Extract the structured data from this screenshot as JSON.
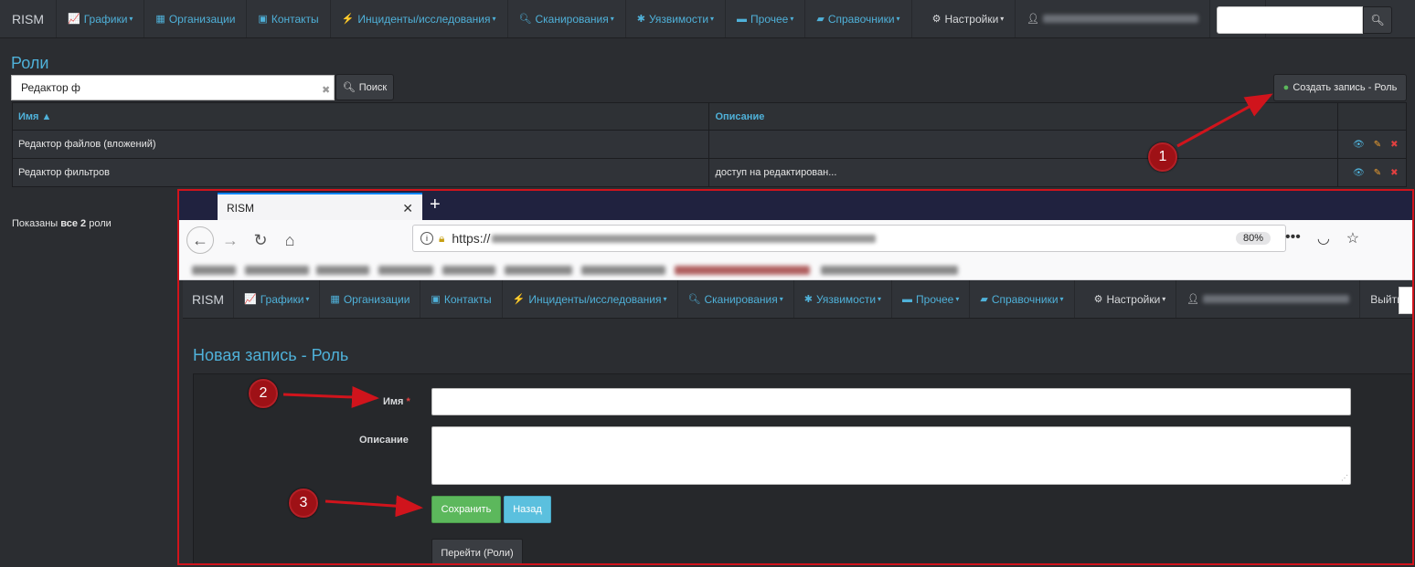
{
  "app": {
    "brand": "RISM"
  },
  "nav": {
    "items": [
      "Графики",
      "Организации",
      "Контакты",
      "Инциденты/исследования",
      "Сканирования",
      "Уязвимости",
      "Прочее",
      "Справочники"
    ],
    "settings": "Настройки",
    "logout": "Выйти"
  },
  "roles_page": {
    "title": "Роли",
    "filter_value": "Редактор ф",
    "search_button": "Поиск",
    "create_button": "Создать запись - Роль",
    "columns": [
      "Имя ▲",
      "Описание"
    ],
    "rows": [
      {
        "name": "Редактор файлов (вложений)",
        "description": ""
      },
      {
        "name": "Редактор фильтров",
        "description": "доступ на редактирован..."
      }
    ],
    "count_prefix": "Показаны",
    "count_bold": "все 2",
    "count_suffix": "роли"
  },
  "browser": {
    "tab_title": "RISM",
    "url_prefix": "https://",
    "zoom": "80%"
  },
  "form": {
    "title": "Новая запись - Роль",
    "name_label": "Имя",
    "required_mark": "*",
    "description_label": "Описание",
    "save_button": "Сохранить",
    "back_button": "Назад",
    "goto_button": "Перейти (Роли)"
  },
  "annotations": [
    "1",
    "2",
    "3"
  ],
  "colors": {
    "accent": "#4fb1d9",
    "marker": "#9e1116",
    "highlight_border": "#d0141c",
    "save": "#5cb85c",
    "back": "#5bc0de"
  }
}
